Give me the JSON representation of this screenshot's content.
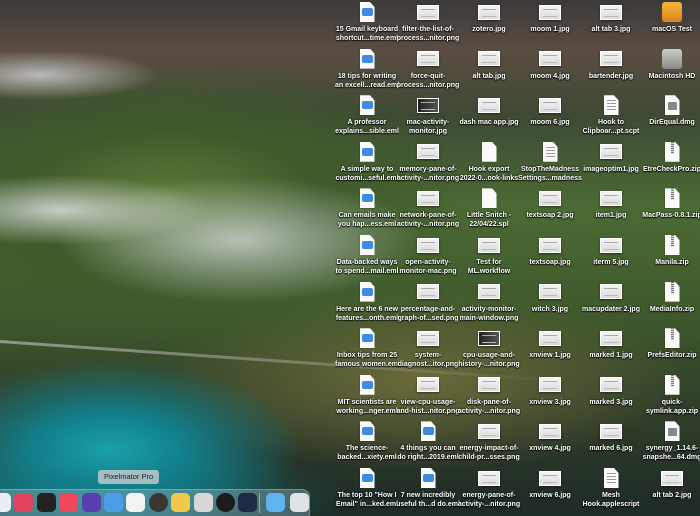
{
  "desktop": {
    "columns": [
      [
        {
          "t": "eml",
          "n": "15 Gmail keyboard",
          "m": "shortcut...time.eml"
        },
        {
          "t": "eml",
          "n": "18 tips for writing",
          "m": "an excell...read.eml"
        },
        {
          "t": "eml",
          "n": "A professor",
          "m": "explains...sible.eml"
        },
        {
          "t": "eml",
          "n": "A simple way to",
          "m": "customi...seful.eml"
        },
        {
          "t": "eml",
          "n": "Can emails make",
          "m": "you hap...ess.eml"
        },
        {
          "t": "eml",
          "n": "Data-backed ways",
          "m": "to spend...mail.eml"
        },
        {
          "t": "eml",
          "n": "Here are the 6 new",
          "m": "features...onth.eml"
        },
        {
          "t": "eml",
          "n": "Inbox tips from 25",
          "m": "famous women.eml"
        },
        {
          "t": "eml",
          "n": "MIT scientists are",
          "m": "working...nger.eml"
        },
        {
          "t": "eml",
          "n": "The science-",
          "m": "backed...xiety.eml"
        },
        {
          "t": "eml",
          "n": "The top 10 \"How I",
          "m": "Email\" in...ked.eml"
        }
      ],
      [
        {
          "t": "img",
          "n": "filter-the-list-of-",
          "m": "process...nitor.png"
        },
        {
          "t": "img",
          "n": "force-quit-",
          "m": "process...nitor.png"
        },
        {
          "t": "imgd",
          "n": "mac-activity-",
          "m": "monitor.jpg"
        },
        {
          "t": "img",
          "n": "memory-pane-of-",
          "m": "activity-...nitor.png"
        },
        {
          "t": "img",
          "n": "network-pane-of-",
          "m": "activity-...nitor.png"
        },
        {
          "t": "img",
          "n": "open-activity-",
          "m": "monitor-mac.png"
        },
        {
          "t": "img",
          "n": "percentage-and-",
          "m": "graph-of...sed.png"
        },
        {
          "t": "img",
          "n": "system-",
          "m": "diagnost...itor.png"
        },
        {
          "t": "img",
          "n": "view-cpu-usage-",
          "m": "and-hist...nitor.png"
        },
        {
          "t": "eml",
          "n": "4 things you can",
          "m": "do right...2019.eml"
        },
        {
          "t": "eml",
          "n": "7 new incredibly",
          "m": "useful th...d do.eml"
        }
      ],
      [
        {
          "t": "img",
          "n": "zotero.jpg",
          "m": ""
        },
        {
          "t": "img",
          "n": "alt tab.jpg",
          "m": ""
        },
        {
          "t": "img",
          "n": "dash mac app.jpg",
          "m": ""
        },
        {
          "t": "doc",
          "n": "Hook export",
          "m": "2022-0...ook-links"
        },
        {
          "t": "doc",
          "n": "Little Snitch -",
          "m": "22/04/22.spl"
        },
        {
          "t": "img",
          "n": "Test for",
          "m": "ML.workflow"
        },
        {
          "t": "img",
          "n": "activity-monitor-",
          "m": "main-window.png"
        },
        {
          "t": "imgd",
          "n": "cpu-usage-and-",
          "m": "history-...nitor.png"
        },
        {
          "t": "img",
          "n": "disk-pane-of-",
          "m": "activity-...nitor.png"
        },
        {
          "t": "img",
          "n": "energy-impact-of-",
          "m": "child-pr...sses.png"
        },
        {
          "t": "img",
          "n": "energy-pane-of-",
          "m": "activity-...nitor.png"
        }
      ],
      [
        {
          "t": "img",
          "n": "moom 1.jpg",
          "m": ""
        },
        {
          "t": "img",
          "n": "moom 4.jpg",
          "m": ""
        },
        {
          "t": "img",
          "n": "moom 6.jpg",
          "m": ""
        },
        {
          "t": "script",
          "n": "StopTheMadness",
          "m": "Settings...madness"
        },
        {
          "t": "img",
          "n": "textsoap 2.jpg",
          "m": ""
        },
        {
          "t": "img",
          "n": "textsoap.jpg",
          "m": ""
        },
        {
          "t": "img",
          "n": "witch 3.jpg",
          "m": ""
        },
        {
          "t": "img",
          "n": "xnview 1.jpg",
          "m": ""
        },
        {
          "t": "img",
          "n": "xnview 3.jpg",
          "m": ""
        },
        {
          "t": "img",
          "n": "xnview 4.jpg",
          "m": ""
        },
        {
          "t": "img",
          "n": "xnview 6.jpg",
          "m": ""
        }
      ],
      [
        {
          "t": "img",
          "n": "alt tab 3.jpg",
          "m": ""
        },
        {
          "t": "img",
          "n": "bartender.jpg",
          "m": ""
        },
        {
          "t": "script",
          "n": "Hook to",
          "m": "Clipboar...pt.scpt"
        },
        {
          "t": "img",
          "n": "imageoptim1.jpg",
          "m": ""
        },
        {
          "t": "img",
          "n": "item1.jpg",
          "m": ""
        },
        {
          "t": "img",
          "n": "iterm 5.jpg",
          "m": ""
        },
        {
          "t": "img",
          "n": "macupdater 2.jpg",
          "m": ""
        },
        {
          "t": "img",
          "n": "marked 1.jpg",
          "m": ""
        },
        {
          "t": "img",
          "n": "marked 3.jpg",
          "m": ""
        },
        {
          "t": "img",
          "n": "marked 6.jpg",
          "m": ""
        },
        {
          "t": "script",
          "n": "Mesh",
          "m": "Hook.applescript"
        }
      ],
      [
        {
          "t": "drive-orange",
          "n": "macOS Test",
          "m": ""
        },
        {
          "t": "drive",
          "n": "Macintosh HD",
          "m": ""
        },
        {
          "t": "dmg",
          "n": "DirEqual.dmg",
          "m": ""
        },
        {
          "t": "zip",
          "n": "EtreCheckPro.zip",
          "m": ""
        },
        {
          "t": "zip",
          "n": "MacPass-0.8.1.zip",
          "m": ""
        },
        {
          "t": "zip",
          "n": "Manila.zip",
          "m": ""
        },
        {
          "t": "zip",
          "n": "MediaInfo.zip",
          "m": ""
        },
        {
          "t": "zip",
          "n": "PrefsEditor.zip",
          "m": ""
        },
        {
          "t": "zip",
          "n": "quick-",
          "m": "symlink.app.zip"
        },
        {
          "t": "dmg",
          "n": "synergy_1.14.6-",
          "m": "snapshe...64.dmg"
        },
        {
          "t": "img",
          "n": "alt tab 2.jpg",
          "m": ""
        }
      ]
    ]
  },
  "dock": {
    "tooltip": "Pixelmator Pro",
    "items": [
      {
        "icon": "finder-icon",
        "color": "#e9eef2"
      },
      {
        "icon": "goodlinks-icon",
        "color": "#e0445e"
      },
      {
        "icon": "terminal-icon",
        "color": "#222222"
      },
      {
        "icon": "music-icon",
        "color": "#f0485a"
      },
      {
        "icon": "purple-app-icon",
        "color": "#5a3fb0"
      },
      {
        "icon": "tweetbot-icon",
        "color": "#4a9ee8"
      },
      {
        "icon": "pixelmator-pro-icon",
        "color": "#f2f2f2"
      },
      {
        "icon": "striped-app-icon",
        "color": "#3a3530"
      },
      {
        "icon": "colorful-app-icon",
        "color": "#f2c94c"
      },
      {
        "icon": "zotero-icon",
        "color": "#d8d8d8"
      },
      {
        "icon": "sync-app-icon",
        "color": "#1c1c1c"
      },
      {
        "icon": "infuse-icon",
        "color": "#1f2a44"
      },
      {
        "icon": "downloads-folder-icon",
        "color": "#5fb3ee"
      },
      {
        "icon": "trash-icon",
        "color": "#dfe3e6"
      }
    ]
  }
}
